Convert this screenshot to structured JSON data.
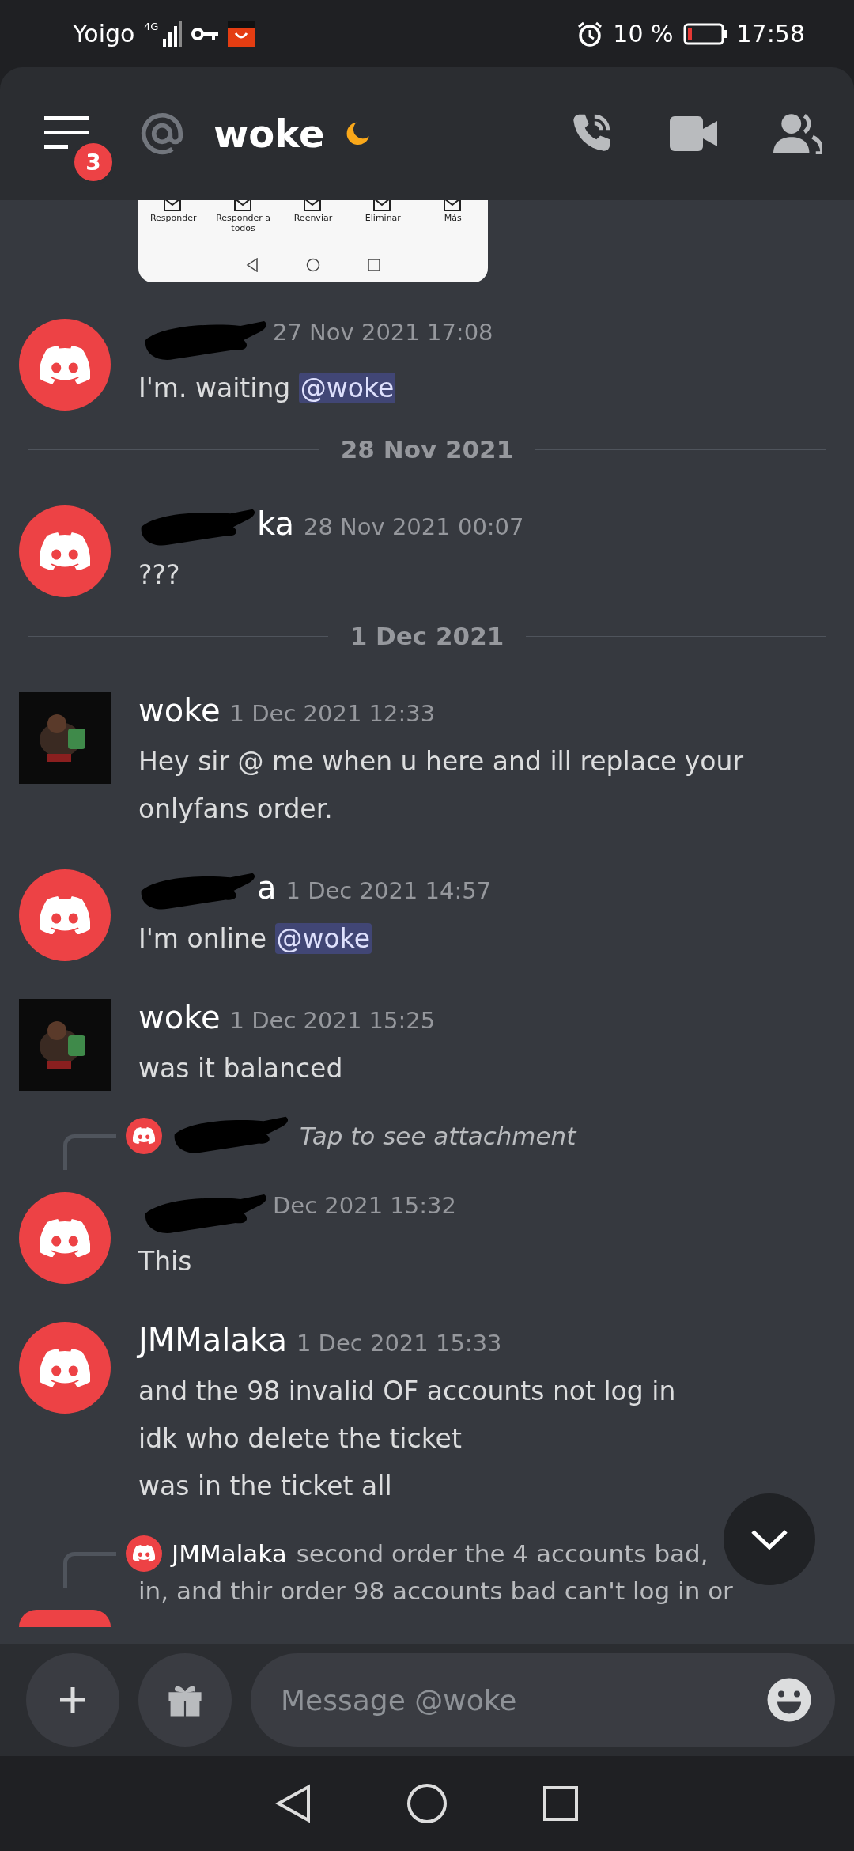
{
  "status_bar": {
    "carrier": "Yoigo",
    "network": "4G",
    "battery_text": "10 %",
    "time": "17:58"
  },
  "header": {
    "unread_badge": "3",
    "channel_name": "woke",
    "idle": true
  },
  "attachment_preview": {
    "actions": [
      "Responder",
      "Responder a todos",
      "Reenviar",
      "Eliminar",
      "Más"
    ]
  },
  "messages": [
    {
      "kind": "message",
      "picture_avatar": false,
      "redacted": true,
      "timestamp": "27 Nov 2021 17:08",
      "lines": [
        "I'm. waiting "
      ],
      "mention": "@woke"
    },
    {
      "kind": "divider",
      "label": "28 Nov 2021"
    },
    {
      "kind": "message",
      "picture_avatar": false,
      "redacted": true,
      "author": "ka",
      "timestamp": "28 Nov 2021 00:07",
      "lines": [
        "???"
      ]
    },
    {
      "kind": "divider",
      "label": "1 Dec 2021"
    },
    {
      "kind": "message",
      "picture_avatar": true,
      "redacted": false,
      "author": "woke",
      "timestamp": "1 Dec 2021 12:33",
      "lines": [
        "Hey sir @ me when u here and ill replace your onlyfans order."
      ]
    },
    {
      "kind": "message",
      "picture_avatar": false,
      "redacted": true,
      "author": "a",
      "timestamp": "1 Dec 2021 14:57",
      "lines": [
        "I'm online "
      ],
      "mention": "@woke"
    },
    {
      "kind": "message",
      "picture_avatar": true,
      "redacted": false,
      "author": "woke",
      "timestamp": "1 Dec 2021 15:25",
      "lines": [
        "was it balanced"
      ]
    },
    {
      "kind": "message",
      "picture_avatar": false,
      "redacted": true,
      "timestamp": "Dec 2021 15:32",
      "lines": [
        "This"
      ],
      "reply": {
        "text": "Tap to see attachment",
        "italic": true
      }
    },
    {
      "kind": "message",
      "picture_avatar": false,
      "redacted": false,
      "author": "JMMalaka",
      "timestamp": "1 Dec 2021 15:33",
      "lines": [
        "and the 98 invalid OF accounts not log in",
        "idk who delete the ticket",
        "was in the ticket all"
      ]
    },
    {
      "kind": "cut_message",
      "reply": {
        "author": "JMMalaka",
        "text": "second order the 4 accounts bad,",
        "text2": "in, and thir order 98 accounts bad can't log in or",
        "italic": false
      }
    }
  ],
  "composer": {
    "placeholder": "Message @woke"
  }
}
